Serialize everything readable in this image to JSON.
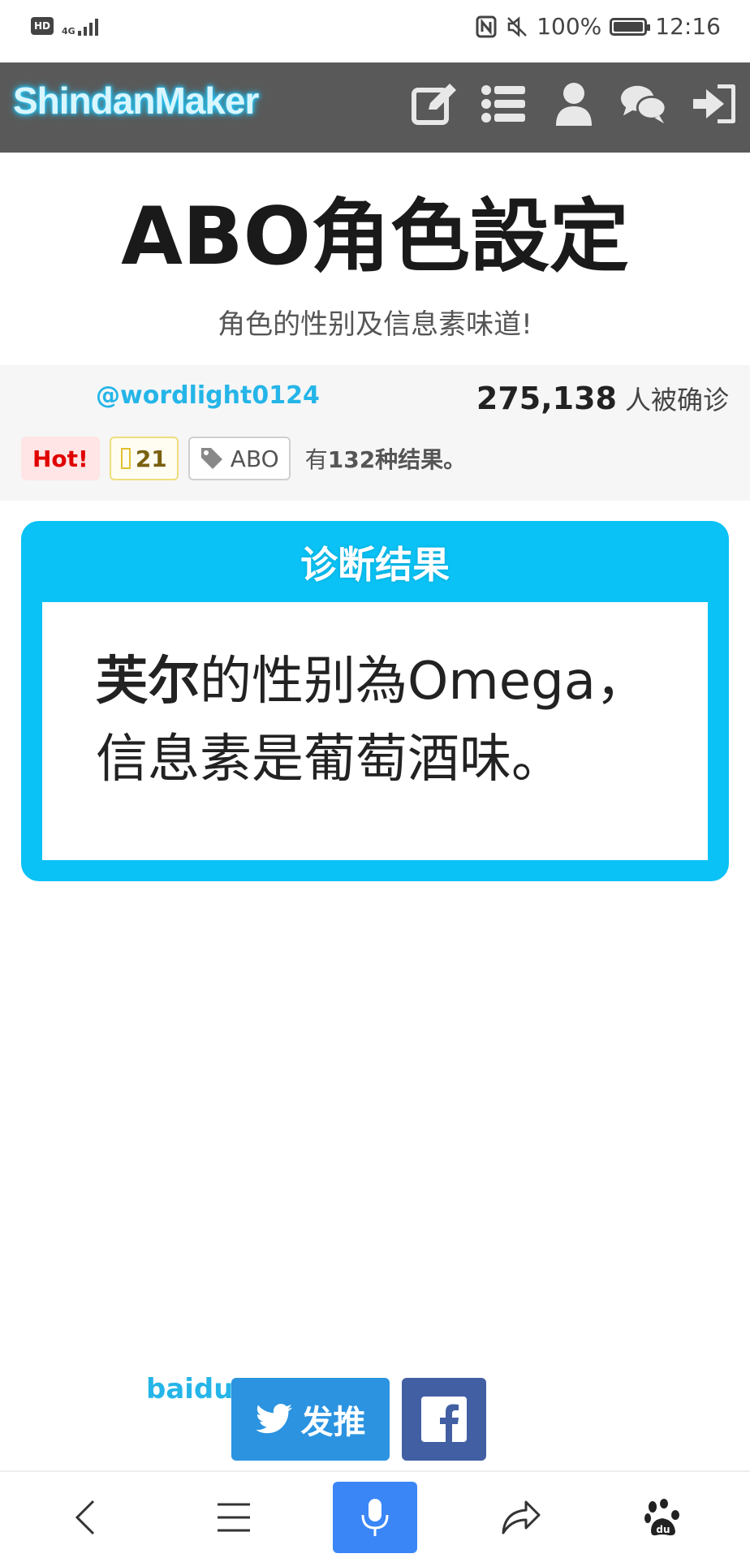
{
  "status_bar": {
    "hd_label": "HD",
    "network_label": "4G",
    "battery_text": "100%",
    "battery_level": 1.0,
    "time": "12:16"
  },
  "header": {
    "logo_text": "ShindanMaker",
    "icons": [
      "edit-icon",
      "list-icon",
      "user-icon",
      "chat-icon",
      "login-icon"
    ]
  },
  "page": {
    "title": "ABO角色設定",
    "subtitle": "角色的性别及信息素味道!"
  },
  "info": {
    "author": "@wordlight0124",
    "count_number": "275,138",
    "count_label": "人被确诊",
    "hot_tag": "Hot!",
    "star_count": "21",
    "tag_name": "ABO",
    "result_count_prefix": "有",
    "result_count_bold": "132种结果。"
  },
  "result": {
    "heading": "诊断结果",
    "name": "芙尔",
    "text_rest": "的性别為Omega，信息素是葡萄酒味。"
  },
  "share": {
    "label": "baidu",
    "tweet_label": "发推"
  },
  "bottom_bar": {
    "items": [
      "back-icon",
      "menu-icon",
      "mic-icon",
      "share-icon",
      "baidu-paw-icon"
    ]
  },
  "colors": {
    "accent": "#0ac2f5",
    "header_bg": "#595959",
    "twitter": "#2b93e0",
    "facebook": "#425fa3",
    "mic": "#3a86f7"
  }
}
